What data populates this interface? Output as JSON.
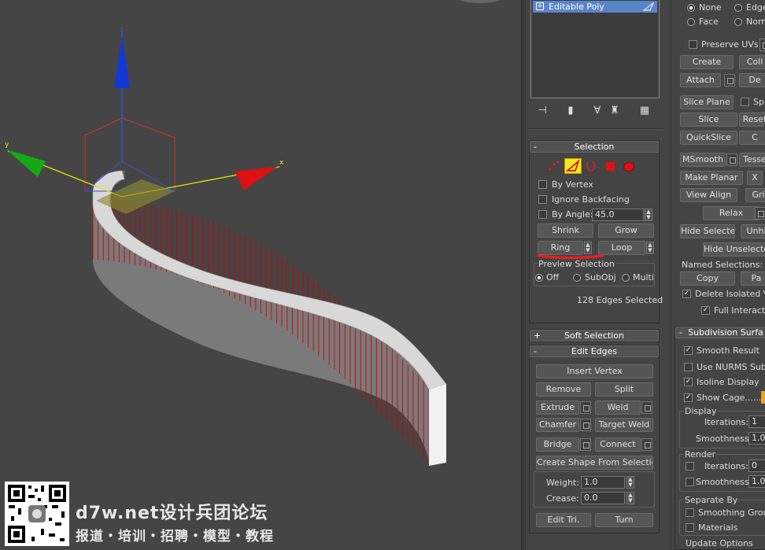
{
  "colors": {
    "viewport_bg": "#454545",
    "accent_selected": "#f5e51d",
    "stack_highlight": "#5a84c8",
    "edge_red": "#d40000",
    "annotation_red": "#ff1a1a",
    "orange_swatch": "#f0a020"
  },
  "viewport": {
    "axes": {
      "x_label": "x",
      "y_label": "y",
      "z_label": "z"
    }
  },
  "watermark": {
    "line1": "d7w.net设计兵团论坛",
    "line2": "报道・培训・招聘・模型・教程"
  },
  "modifier_stack": {
    "items": [
      {
        "label": "Editable Poly",
        "expand": "+"
      }
    ],
    "tool_icons": [
      "pin-stack-icon",
      "show-end-result-icon",
      "make-unique-icon",
      "remove-modifier-icon",
      "configure-modifier-sets-icon"
    ]
  },
  "selection": {
    "title": "Selection",
    "collapse": "-",
    "levels": [
      "vertex",
      "edge",
      "border",
      "polygon",
      "element"
    ],
    "active_level": "edge",
    "by_vertex": "By Vertex",
    "ignore_backfacing": "Ignore Backfacing",
    "by_angle": "By Angle:",
    "by_angle_value": "45.0",
    "shrink": "Shrink",
    "grow": "Grow",
    "ring": "Ring",
    "loop": "Loop",
    "preview_selection": "Preview Selection",
    "preview_off": "Off",
    "preview_subobj": "SubObj",
    "preview_multi": "Multi",
    "status": "128 Edges Selected"
  },
  "soft_selection": {
    "title": "Soft Selection",
    "expand": "+"
  },
  "edit_edges": {
    "title": "Edit Edges",
    "collapse": "-",
    "insert_vertex": "Insert Vertex",
    "remove": "Remove",
    "split": "Split",
    "extrude": "Extrude",
    "weld": "Weld",
    "chamfer": "Chamfer",
    "target_weld": "Target Weld",
    "bridge": "Bridge",
    "connect": "Connect",
    "create_shape": "Create Shape From Selection",
    "weight_label": "Weight:",
    "weight_value": "1.0",
    "crease_label": "Crease:",
    "crease_value": "0.0",
    "edit_tri": "Edit Tri.",
    "turn": "Turn"
  },
  "right_panel": {
    "radio_none": "None",
    "radio_edge": "Edge",
    "radio_face": "Face",
    "radio_norm": "Norm",
    "preserve_uvs": "Preserve UVs",
    "create": "Create",
    "coll": "Coll",
    "attach": "Attach",
    "de": "De",
    "slice_plane": "Slice Plane",
    "spl": "Spl",
    "slice": "Slice",
    "reset": "Reset",
    "quickslice": "QuickSlice",
    "c": "C",
    "msmooth": "MSmooth",
    "tesse": "Tesse",
    "make_planar": "Make Planar",
    "x": "X",
    "view_align": "View Align",
    "grid": "Grid",
    "relax": "Relax",
    "hide_selected": "Hide Selected",
    "unhi": "Unhi",
    "hide_unselected": "Hide Unselected",
    "named_selections": "Named Selections:",
    "copy": "Copy",
    "pa": "Pa",
    "delete_isolated": "Delete Isolated Ve",
    "full_interactive": "Full Interactiv",
    "subdiv_title": "Subdivision Surfa",
    "subdiv_collapse": "-",
    "smooth_result": "Smooth Result",
    "use_nurms": "Use NURMS Subdiv",
    "isoline": "Isoline Display",
    "show_cage": "Show Cage......",
    "display": "Display",
    "iterations_label": "Iterations:",
    "display_iterations": "1",
    "smoothness_label": "Smoothness:",
    "display_smoothness": "1.0",
    "render": "Render",
    "render_iterations": "0",
    "render_smoothness": "1.0",
    "separate_by": "Separate By",
    "smoothing_groups": "Smoothing Groups",
    "materials": "Materials",
    "update_options": "Update Options"
  }
}
